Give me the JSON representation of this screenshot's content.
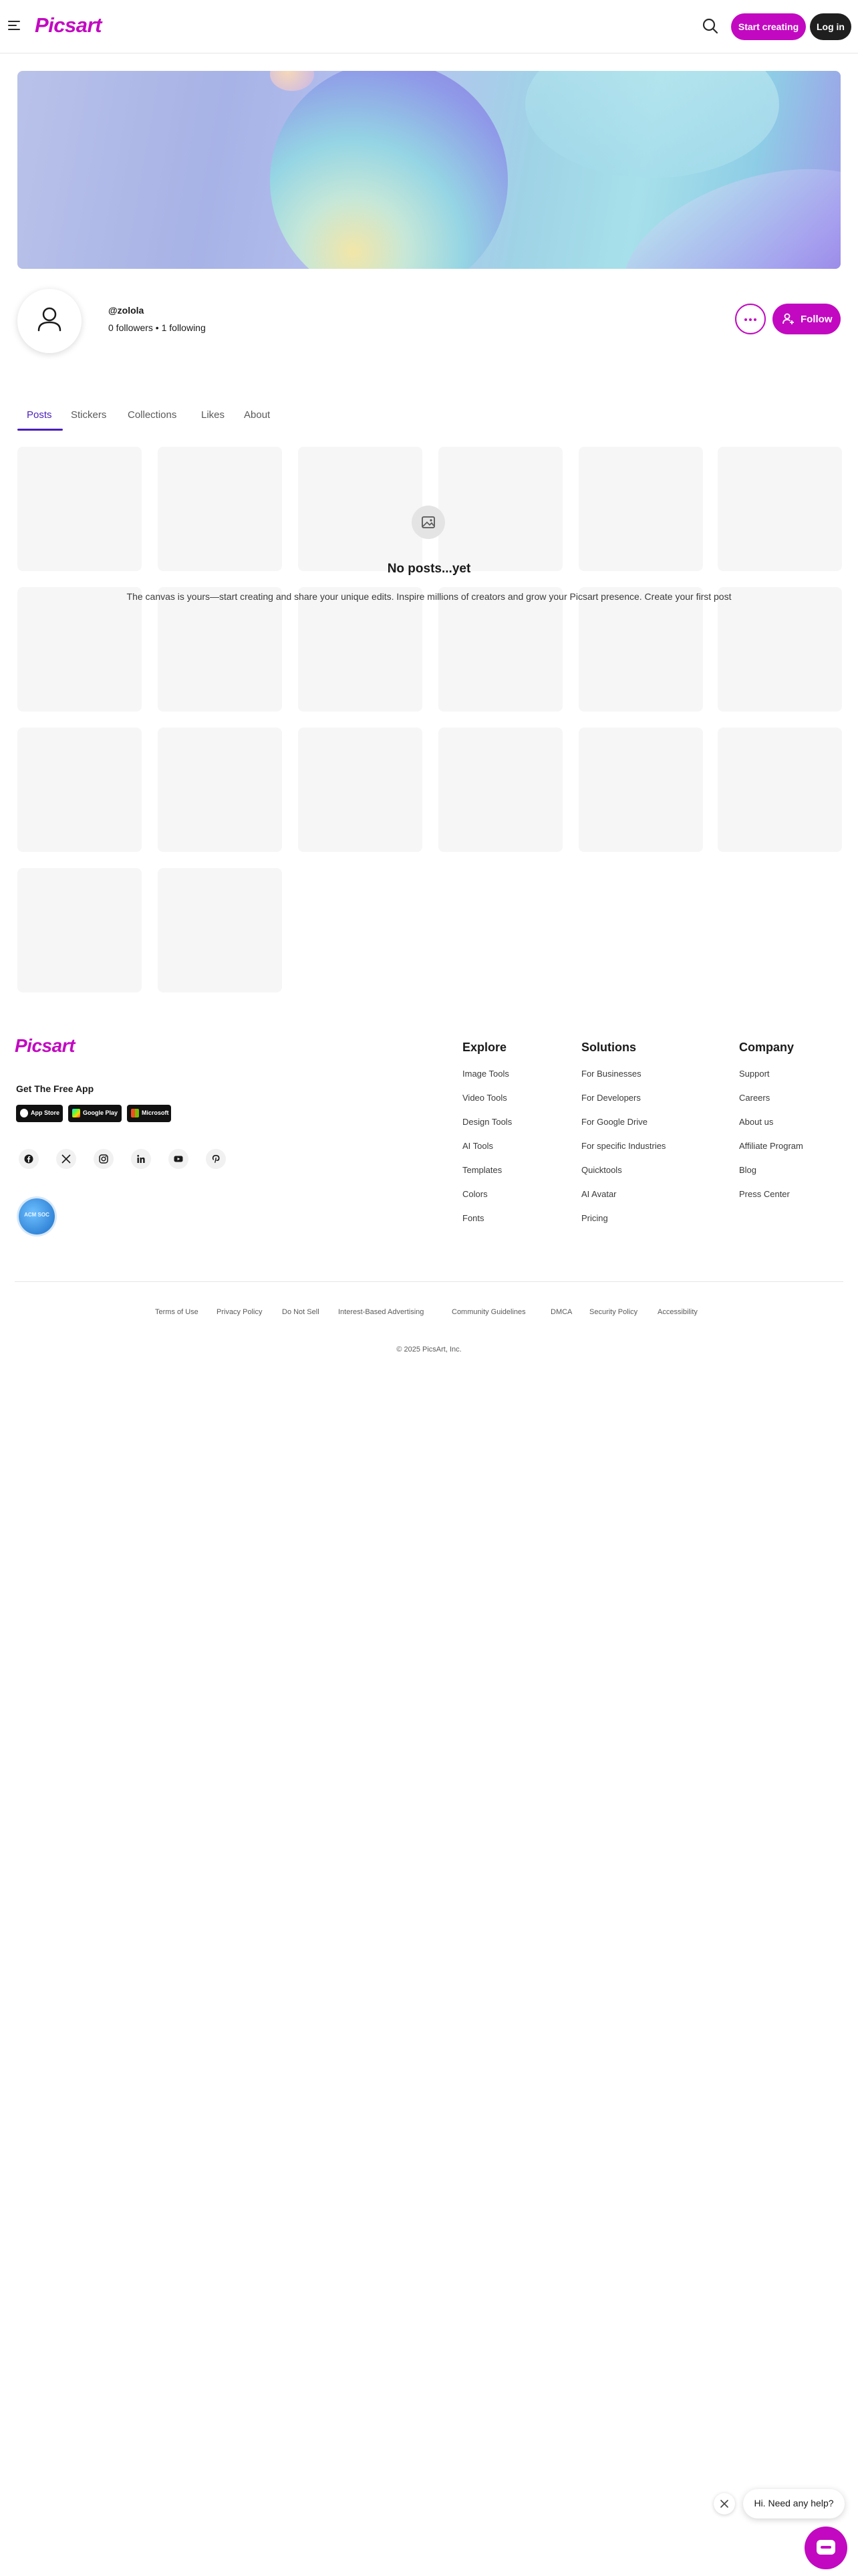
{
  "header": {
    "logo": "Picsart",
    "start_label": "Start creating",
    "login_label": "Log in",
    "icons": [
      "menu-icon",
      "search-icon"
    ]
  },
  "profile": {
    "username": "@zolola",
    "stats": "0 followers • 1 following",
    "follow_label": "Follow"
  },
  "tabs": [
    {
      "label": "Posts",
      "active": true
    },
    {
      "label": "Stickers",
      "active": false
    },
    {
      "label": "Collections",
      "active": false
    },
    {
      "label": "Likes",
      "active": false
    },
    {
      "label": "About",
      "active": false
    }
  ],
  "empty_state": {
    "title": "No posts...yet",
    "text": "The canvas is yours—start creating and share your unique edits. Inspire millions of creators and grow your Picsart presence. Create your first post"
  },
  "footer": {
    "logo": "Picsart",
    "get_app": "Get The Free App",
    "stores": [
      "App Store",
      "Google Play",
      "Microsoft"
    ],
    "social_icons": [
      "facebook-icon",
      "x-icon",
      "instagram-icon",
      "linkedin-icon",
      "youtube-icon",
      "pinterest-icon"
    ],
    "badge": "ACM SOC",
    "columns": [
      {
        "title": "Explore",
        "links": [
          "Image Tools",
          "Video Tools",
          "Design Tools",
          "AI Tools",
          "Templates",
          "Colors",
          "Fonts"
        ]
      },
      {
        "title": "Solutions",
        "links": [
          "For Businesses",
          "For Developers",
          "For Google Drive",
          "For specific Industries",
          "Quicktools",
          "AI Avatar",
          "Pricing"
        ]
      },
      {
        "title": "Company",
        "links": [
          "Support",
          "Careers",
          "About us",
          "Affiliate Program",
          "Blog",
          "Press Center"
        ]
      }
    ],
    "legal": [
      "Terms of Use",
      "Privacy Policy",
      "Do Not Sell",
      "Interest-Based Advertising",
      "Community Guidelines",
      "DMCA",
      "Security Policy",
      "Accessibility"
    ],
    "copyright": "© 2025 PicsArt, Inc."
  },
  "chat": {
    "message": "Hi. Need any help?"
  },
  "colors": {
    "brand": "#c209c1",
    "tab_active": "#4a1fb8"
  }
}
